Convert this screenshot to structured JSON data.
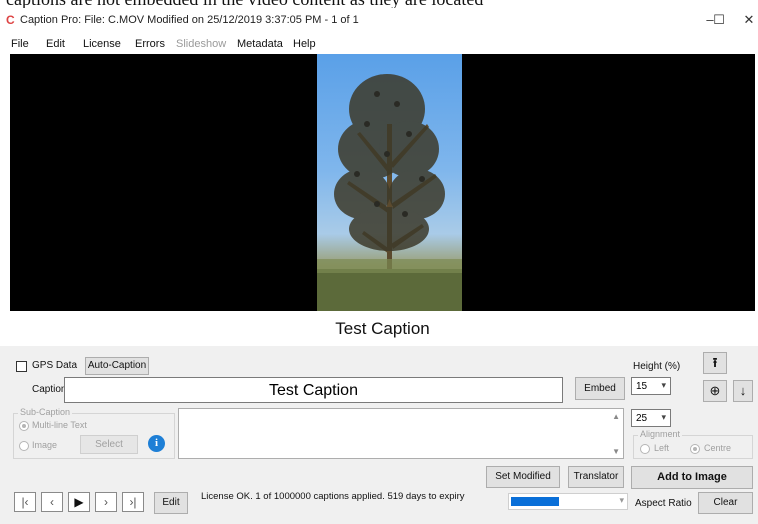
{
  "window": {
    "title": "Caption Pro: File: C.MOV Modified on 25/12/2019 3:37:05 PM - 1 of 1",
    "minimize": "–",
    "maximize": "☐",
    "close": "✕"
  },
  "menu": {
    "items": [
      "File",
      "Edit",
      "License",
      "Errors",
      "Slideshow",
      "Metadata",
      "Help"
    ]
  },
  "preview": {
    "caption_text": "Test Caption"
  },
  "controls": {
    "gps_label": "GPS Data",
    "auto_caption": "Auto-Caption",
    "height_label": "Height (%)",
    "caption_label": "Caption",
    "caption_value": "Test Caption",
    "embed": "Embed",
    "height_value": "15",
    "subcaption_group": "Sub-Caption",
    "multiline_label": "Multi-line Text",
    "image_label": "Image",
    "select": "Select",
    "sub_value": "25",
    "alignment_group": "Alignment",
    "left_label": "Left",
    "centre_label": "Centre",
    "set_modified": "Set Modified",
    "translator": "Translator",
    "add_to_image": "Add to Image",
    "edit": "Edit",
    "status": "License OK. 1 of 1000000 captions applied. 519 days to expiry",
    "aspect_ratio": "Aspect Ratio",
    "clear": "Clear",
    "progress_fraction": 0.5,
    "colors": {
      "progress": "#0a6fd8",
      "info": "#1e7fd6"
    }
  }
}
